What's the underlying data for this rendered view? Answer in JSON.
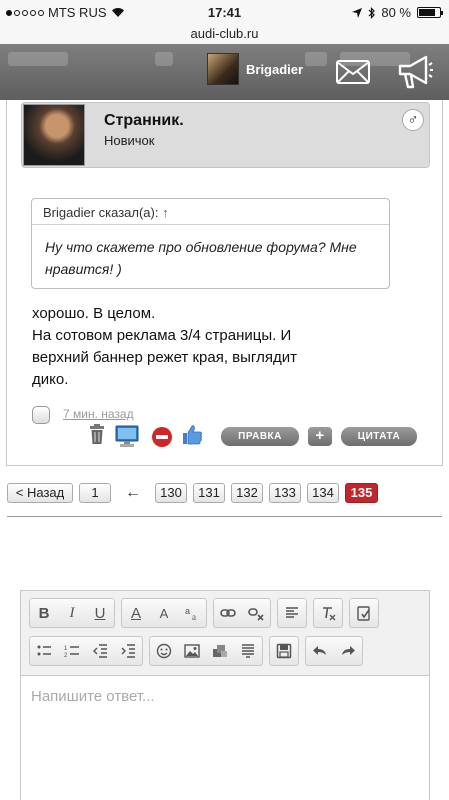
{
  "status": {
    "carrier": "MTS RUS",
    "time": "17:41",
    "battery": "80 %"
  },
  "browser": {
    "url": "audi-club.ru"
  },
  "topbar": {
    "username": "Brigadier"
  },
  "post": {
    "author": "Странник.",
    "rank": "Новичок",
    "gender_symbol": "♂",
    "quote_author_line": "Brigadier сказал(а):",
    "quote_link": "↑",
    "quote_text": "Ну что скажете про обновление форума? Мне нравится! )",
    "text_lines": [
      "хорошо. В целом.",
      "На сотовом реклама 3/4 страницы. И",
      "верхний баннер режет края, выглядит",
      "дико."
    ],
    "time": "7 мин. назад",
    "edit_label": "ПРАВКА",
    "plus_label": "+",
    "quote_label": "ЦИТАТА"
  },
  "pagination": {
    "back_label": "< Назад",
    "first_page": "1",
    "arrow": "←",
    "pages": [
      "130",
      "131",
      "132",
      "133",
      "134",
      "135"
    ],
    "current": "135"
  },
  "editor": {
    "placeholder": "Напишите ответ...",
    "tools": {
      "bold": "B",
      "italic": "I",
      "underline": "U",
      "font_color": "A",
      "font_size": "A",
      "clear_format": "T"
    }
  },
  "colors": {
    "accent_red": "#c0262c",
    "topbar": "#6e6e6e"
  }
}
